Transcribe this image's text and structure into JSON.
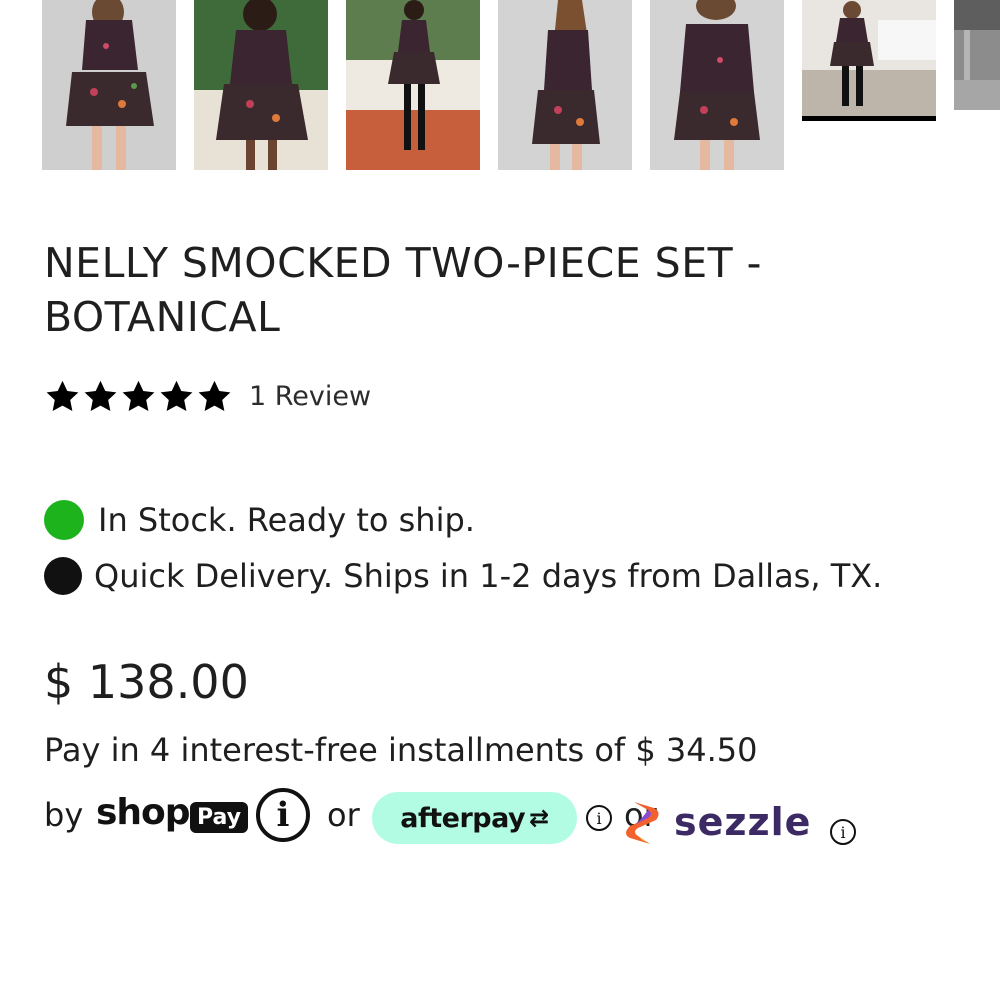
{
  "gallery": {
    "thumbnails": [
      {
        "alt": "thumbnail-1",
        "bg": "#cfcfcf"
      },
      {
        "alt": "thumbnail-2",
        "bg": "#3f6b3a"
      },
      {
        "alt": "thumbnail-3",
        "bg": "#5d7d4f"
      },
      {
        "alt": "thumbnail-4",
        "bg": "#d3d3d3"
      },
      {
        "alt": "thumbnail-5",
        "bg": "#d3d3d3"
      },
      {
        "alt": "thumbnail-6",
        "bg": "#e9e6e2"
      },
      {
        "alt": "thumbnail-7",
        "bg": "#8c8c8c"
      }
    ],
    "selected_index": 5
  },
  "product": {
    "title_line1": "NELLY SMOCKED TWO-PIECE SET -",
    "title_line2": "BOTANICAL",
    "rating": 5,
    "review_text": "1 Review",
    "stock_text": "In Stock. Ready to ship.",
    "delivery_text": "Quick Delivery. Ships in 1-2 days from Dallas, TX.",
    "price": "$ 138.00",
    "installments_text": "Pay in 4 interest-free installments of $ 34.50"
  },
  "payment": {
    "by_label": "by",
    "shop_word": "shop",
    "pay_badge": "Pay",
    "info_glyph": "i",
    "or_label": "or",
    "afterpay_label": "afterpay",
    "afterpay_icon": "⇄",
    "sezzle_covered_text": "or",
    "sezzle_label": "sezzle",
    "small_info_glyph": "i"
  },
  "colors": {
    "stock_green": "#1db31d",
    "delivery_black": "#111111",
    "afterpay_mint": "#b2fce4",
    "sezzle_purple": "#3b2a63"
  }
}
